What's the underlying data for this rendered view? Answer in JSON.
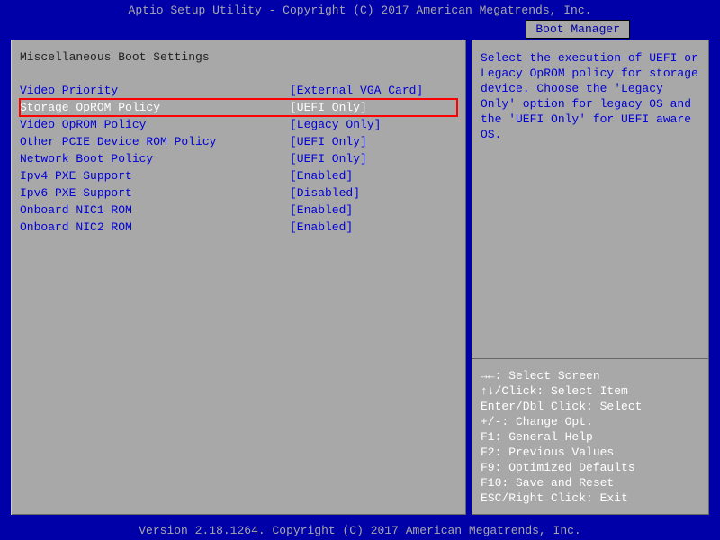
{
  "header": {
    "title": "Aptio Setup Utility - Copyright (C) 2017 American Megatrends, Inc."
  },
  "tab": {
    "label": "Boot Manager"
  },
  "section": {
    "title": "Miscellaneous Boot Settings"
  },
  "settings": [
    {
      "label": "Video Priority",
      "value": "[External VGA Card]"
    },
    {
      "label": "Storage OpROM Policy",
      "value": "[UEFI Only]"
    },
    {
      "label": "Video OpROM Policy",
      "value": "[Legacy Only]"
    },
    {
      "label": "Other PCIE Device ROM Policy",
      "value": "[UEFI Only]"
    },
    {
      "label": "Network Boot Policy",
      "value": "[UEFI Only]"
    },
    {
      "label": "Ipv4 PXE Support",
      "value": "[Enabled]"
    },
    {
      "label": "Ipv6 PXE Support",
      "value": "[Disabled]"
    },
    {
      "label": "Onboard NIC1 ROM",
      "value": "[Enabled]"
    },
    {
      "label": "Onboard NIC2 ROM",
      "value": "[Enabled]"
    }
  ],
  "help": {
    "text": "Select the execution of UEFI or Legacy OpROM policy for storage device. Choose the 'Legacy Only' option for legacy OS and the 'UEFI Only' for UEFI aware OS."
  },
  "nav": {
    "line1": "→←: Select Screen",
    "line2": "↑↓/Click: Select Item",
    "line3": "Enter/Dbl Click: Select",
    "line4": "+/-: Change Opt.",
    "line5": "F1: General Help",
    "line6": "F2: Previous Values",
    "line7": "F9: Optimized Defaults",
    "line8": "F10: Save and Reset",
    "line9": "ESC/Right Click: Exit"
  },
  "footer": {
    "text": "Version 2.18.1264. Copyright (C) 2017 American Megatrends, Inc."
  }
}
